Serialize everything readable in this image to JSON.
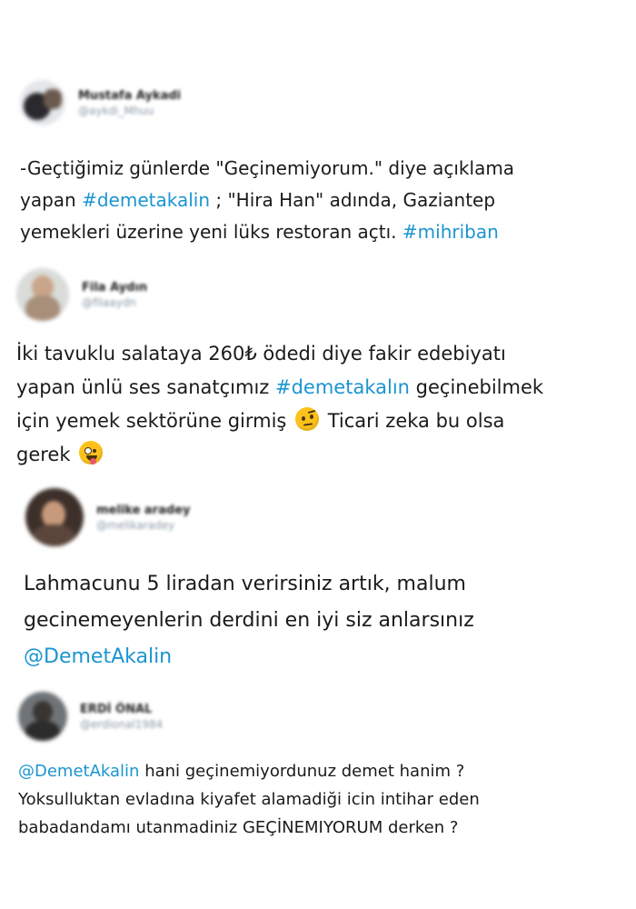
{
  "tweets": [
    {
      "user": {
        "name": "Mustafa Aykadi",
        "handle": "@aykdi_Mhuu"
      },
      "lines": [
        [
          {
            "t": "-Geçtiğimiz günlerde \"Geçinemiyorum.\" diye açıklama"
          }
        ],
        [
          {
            "t": "yapan "
          },
          {
            "t": "#demetakalin",
            "link": true
          },
          {
            "t": " ; \"Hira Han\" adında, Gaziantep"
          }
        ],
        [
          {
            "t": "yemekleri üzerine yeni lüks restoran açtı. "
          },
          {
            "t": "#mihriban",
            "link": true
          }
        ]
      ]
    },
    {
      "user": {
        "name": "Fila Aydın",
        "handle": "@filaaydn"
      },
      "lines": [
        [
          {
            "t": "İki tavuklu salataya 260₺ ödedi diye fakir edebiyatı"
          }
        ],
        [
          {
            "t": "yapan ünlü ses sanatçımız "
          },
          {
            "t": "#demetakalın",
            "link": true
          },
          {
            "t": " geçinebilmek"
          }
        ],
        [
          {
            "t": "için yemek sektörüne girmiş "
          },
          {
            "emoji": "raised-eyebrow-face-icon"
          },
          {
            "t": " Ticari zeka bu olsa"
          }
        ],
        [
          {
            "t": "gerek "
          },
          {
            "emoji": "zany-face-icon"
          }
        ]
      ]
    },
    {
      "user": {
        "name": "melike aradey",
        "handle": "@melikaradey"
      },
      "lines": [
        [
          {
            "t": "Lahmacunu 5 liradan verirsiniz artık, malum"
          }
        ],
        [
          {
            "t": "gecinemeyenlerin derdini en iyi siz anlarsınız"
          }
        ],
        [
          {
            "t": "@DemetAkalin",
            "link": true
          }
        ]
      ]
    },
    {
      "user": {
        "name": "ERDİ ÖNAL",
        "handle": "@erdional1984"
      },
      "lines": [
        [
          {
            "t": "@DemetAkalin",
            "link": true
          },
          {
            "t": " hani geçinemiyordunuz demet hanim ?"
          }
        ],
        [
          {
            "t": "Yoksulluktan evladına kiyafet alamadiği icin intihar eden"
          }
        ],
        [
          {
            "t": "babadandamı utanmadiniz GEÇİNEMIYORUM derken ?"
          }
        ]
      ]
    }
  ],
  "colors": {
    "link": "#1b95d0",
    "text": "#1a1a1a",
    "handle": "#8a9aa8"
  }
}
